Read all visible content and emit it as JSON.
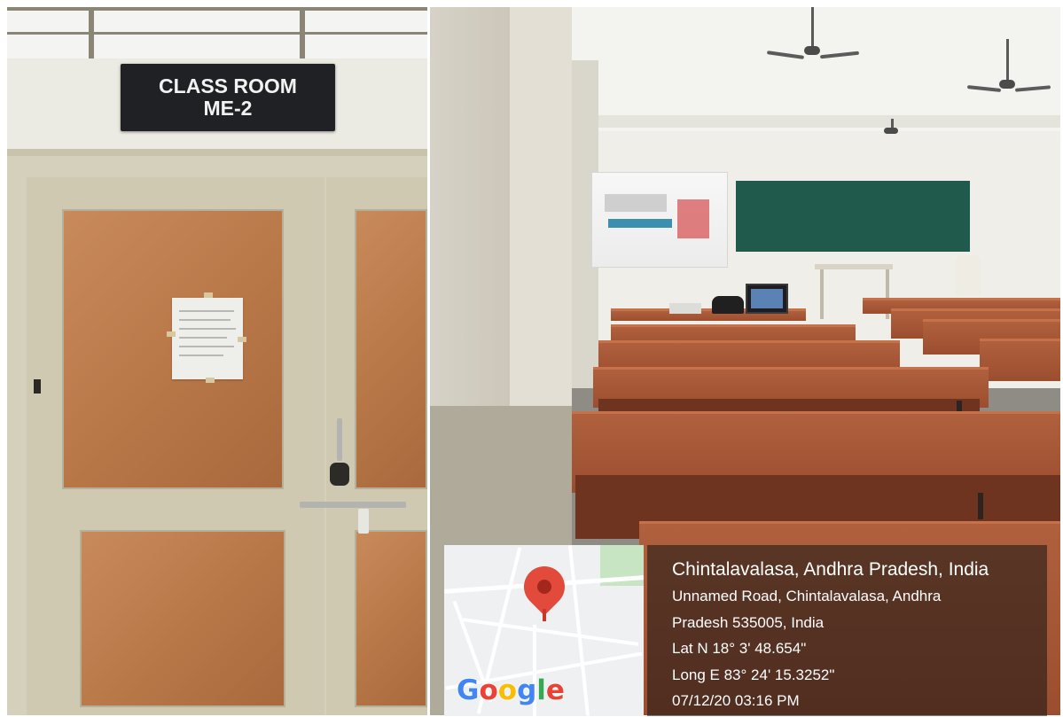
{
  "door_photo": {
    "sign": {
      "line1": "CLASS ROOM",
      "line2": "ME-2"
    }
  },
  "location_stamp": {
    "map_brand": "Google",
    "place": "Chintalavalasa, Andhra Pradesh, India",
    "address_line1": "Unnamed Road, Chintalavalasa, Andhra",
    "address_line2": "Pradesh 535005, India",
    "latitude": "Lat N 18° 3' 48.654\"",
    "longitude": "Long E 83° 24' 15.3252\"",
    "timestamp": "07/12/20 03:16 PM",
    "colors": {
      "pin": "#e24a3b",
      "overlay": "#141414",
      "google_blue": "#4285f4",
      "google_red": "#ea4335",
      "google_yellow": "#fbbc05",
      "google_green": "#34a853"
    },
    "icons": [
      "map-pin-icon"
    ]
  }
}
